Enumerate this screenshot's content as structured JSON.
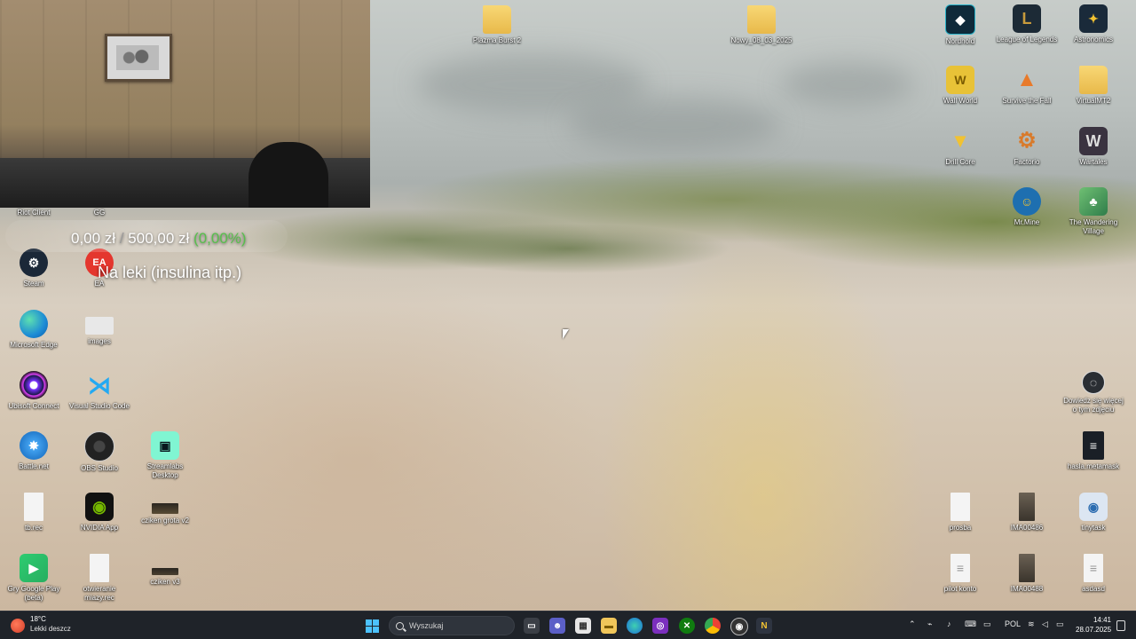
{
  "desktop_icons": {
    "plazma_burst": "Plazma Burst 2",
    "nowy_folder": "Nowy_08_03_2025",
    "nordhold": "Nordhold",
    "league": "League of Legends",
    "astronomics": "Astronomics",
    "wall_world": "Wall World",
    "survive_fall": "Survive the Fall",
    "virtual_mt2": "VirtualMT2",
    "drill_core": "Drill Core",
    "factorio": "Factorio",
    "wartales": "Wartales",
    "mr_mine": "Mr.Mine",
    "wandering_village": "The Wandering Village",
    "riot_client": "Riot Client",
    "gg": "GG",
    "steam": "Steam",
    "ea": "EA",
    "edge": "Microsoft Edge",
    "images": "images",
    "ubisoft": "Ubisoft Connect",
    "vscode": "Visual Studio Code",
    "battlenet": "Battle.net",
    "obs": "OBS Studio",
    "streamlabs": "Streamlabs Desktop",
    "tb_rec": "tb.rec",
    "nvidia": "NVIDIA App",
    "cziken_grota": "cziken grota v2",
    "google_play": "Gry Google Play (beta)",
    "otwieranie": "otwieranie miazy.rec",
    "cziken_v3": "cziken v3",
    "dowiedz": "Dowiedz się więcej o tym zdjęciu",
    "hasla": "hasla.metamask",
    "prosba": "prosba",
    "ima_486": "IMA00486",
    "tinytask": "tinytask",
    "pilot_konto": "pilot konto",
    "ima_488": "IMA00488",
    "asdasd": "asdasd"
  },
  "overlay": {
    "current": "0,00 zł",
    "separator": "/",
    "goal": "500,00 zł",
    "percent": "(0,00%)",
    "goal_title": "Na leki (insulina itp.)"
  },
  "taskbar": {
    "weather_temp": "18°C",
    "weather_desc": "Lekki deszcz",
    "search_placeholder": "Wyszukaj",
    "language": "POL",
    "time": "14:41",
    "date": "28.07.2025"
  },
  "colors": {
    "taskbar_bg": "#1f2329",
    "progress_green": "#57c04c",
    "folder_yellow": "#f0c65a"
  }
}
